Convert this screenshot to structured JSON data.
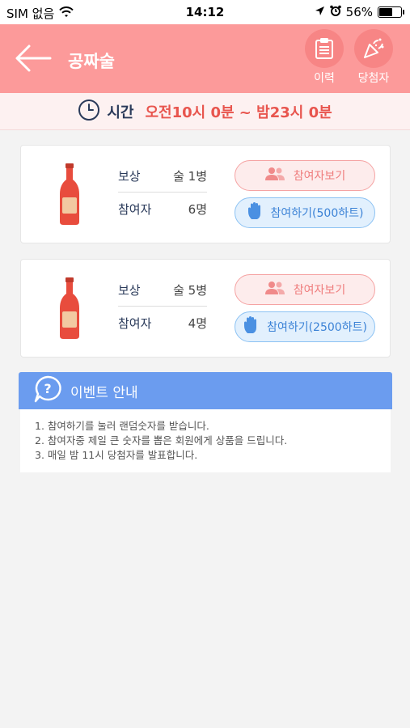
{
  "status_bar": {
    "carrier": "SIM 없음",
    "time": "14:12",
    "battery_percent": "56%",
    "battery_level": 0.56
  },
  "header": {
    "title": "공짜술",
    "history_label": "이력",
    "winner_label": "당첨자",
    "background_color": "#fc9a9a"
  },
  "time_bar": {
    "label": "시간",
    "value": "오전10시 0분 ~ 밤23시 0분"
  },
  "cards": [
    {
      "reward_label": "보상",
      "reward_value": "술 1병",
      "participants_label": "참여자",
      "participants_value": "6명",
      "view_button": "참여자보기",
      "join_button": "참여하기(500하트)"
    },
    {
      "reward_label": "보상",
      "reward_value": "술 5병",
      "participants_label": "참여자",
      "participants_value": "4명",
      "view_button": "참여자보기",
      "join_button": "참여하기(2500하트)"
    }
  ],
  "notice": {
    "title": "이벤트 안내",
    "lines": [
      "1. 참여하기를 눌러 랜덤숫자를 받습니다.",
      "2. 참여자중 제일 큰 숫자를 뽑은 회원에게 상품을 드립니다.",
      "3. 매일 밤 11시 당첨자를 발표합니다."
    ]
  },
  "colors": {
    "accent": "#fc9a9a",
    "time_text": "#e8554e",
    "notice_blue": "#6b9cef"
  }
}
